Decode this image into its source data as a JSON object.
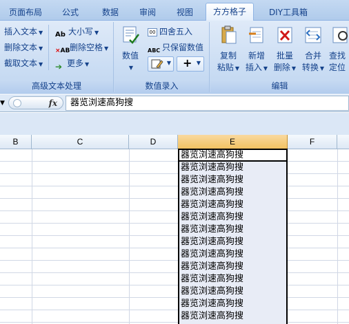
{
  "tabs": [
    {
      "label": "页面布局",
      "active": false
    },
    {
      "label": "公式",
      "active": false
    },
    {
      "label": "数据",
      "active": false
    },
    {
      "label": "审阅",
      "active": false
    },
    {
      "label": "视图",
      "active": false
    },
    {
      "label": "方方格子",
      "active": true
    },
    {
      "label": "DIY工具箱",
      "active": false
    }
  ],
  "ribbon": {
    "group_text": {
      "label": "高级文本处理",
      "insert_text": "插入文本",
      "delete_text": "删除文本",
      "extract_text": "截取文本",
      "case": "大小写",
      "delete_space": "删除空格",
      "more": "更多"
    },
    "group_data": {
      "label": "数值录入",
      "number_top": "数值",
      "round": "四舍五入",
      "keep_value": "只保留数值"
    },
    "group_edit": {
      "label": "编辑",
      "copy_top": "复制",
      "copy_bottom": "粘贴",
      "add_top": "新增",
      "add_bottom": "插入",
      "batch_top": "批量",
      "batch_bottom": "删除",
      "merge_top": "合并",
      "merge_bottom": "转换",
      "find_top": "查找",
      "find_bottom": "定位"
    }
  },
  "formula_bar": {
    "fx": "fx",
    "content": "器览浏速高狗搜"
  },
  "columns": [
    "B",
    "C",
    "D",
    "E",
    "F"
  ],
  "selected_column": "E",
  "cells_e": [
    "器览浏速高狗搜",
    "器览浏速高狗搜",
    "器览浏速高狗搜",
    "器览浏速高狗搜",
    "器览浏速高狗搜",
    "器览浏速高狗搜",
    "器览浏速高狗搜",
    "器览浏速高狗搜",
    "器览浏速高狗搜",
    "器览浏速高狗搜",
    "器览浏速高狗搜",
    "器览浏速高狗搜",
    "器览浏速高狗搜",
    "器览浏速高狗搜"
  ],
  "colors": {
    "ribbon_bg": "#c9dcf3",
    "ribbon_text": "#15428b",
    "selected_header": "#f1c15f",
    "selected_col_bg": "#e8ecf6"
  }
}
